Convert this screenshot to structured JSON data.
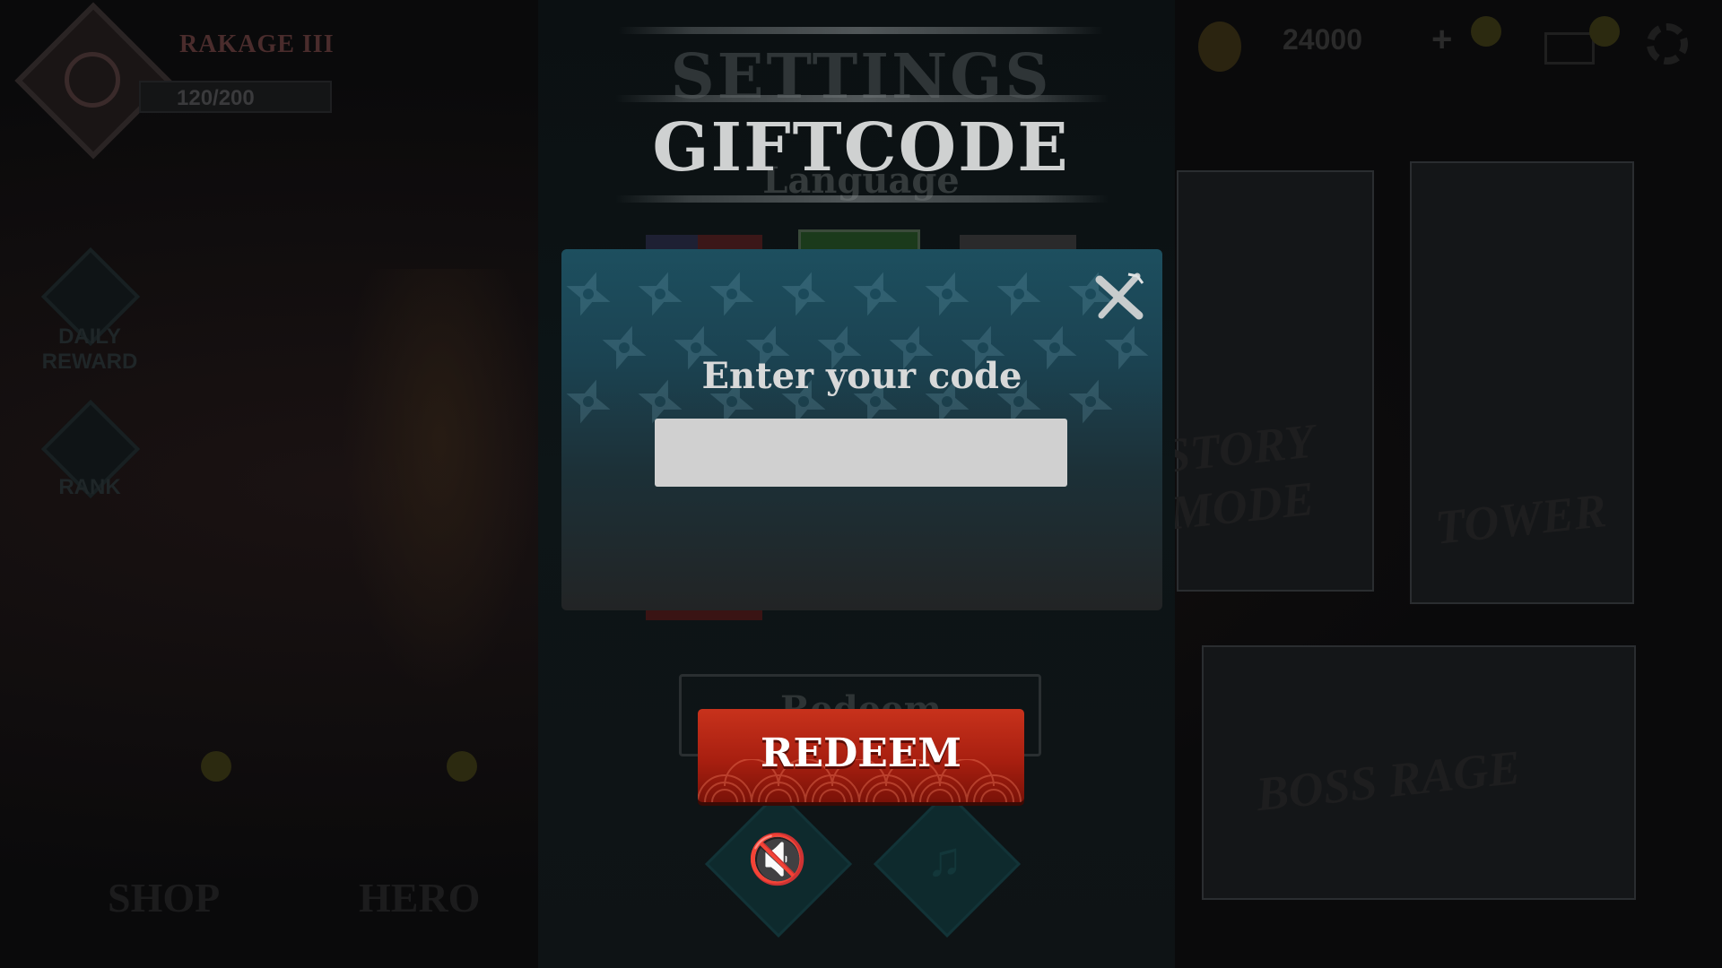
{
  "background": {
    "player_name": "RAKAGE III",
    "exp": "120/200",
    "daily_reward": "DAILY\nREWARD",
    "rank": "RANK",
    "shop": "SHOP",
    "hero": "HERO",
    "gold": "24000",
    "plus": "+",
    "story_mode": "STORY\nMODE",
    "tower": "TOWER",
    "boss_rage": "BOSS RAGE"
  },
  "settings": {
    "title": "SETTINGS",
    "language_label": "Language",
    "redeem_giftcode": "Redeem Giftcode"
  },
  "giftcode_title": "GIFTCODE",
  "modal": {
    "prompt": "Enter your code",
    "code_value": "",
    "code_placeholder": ""
  },
  "redeem_button": "REDEEM",
  "colors": {
    "modal_top": "#1d4f5f",
    "redeem_red": "#b82614",
    "input_bg": "#d0d0d0"
  },
  "icons": {
    "close": "close-x-icon",
    "sound": "speaker-mute-icon",
    "music": "music-mute-icon"
  }
}
